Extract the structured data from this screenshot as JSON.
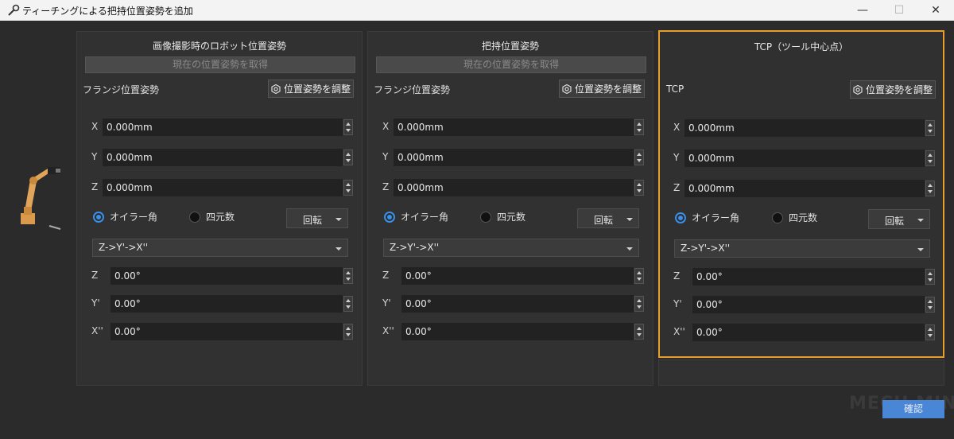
{
  "window": {
    "title": "ティーチングによる把持位置姿勢を追加",
    "icon": "wrench-icon",
    "minimize": "—",
    "maximize": "☐",
    "close": "✕"
  },
  "colors": {
    "accent": "#e89c2c",
    "primary": "#4a86d6",
    "radio": "#3a8fe8"
  },
  "panels": [
    {
      "title": "画像撮影時のロボット位置姿勢",
      "get_button": "現在の位置姿勢を取得",
      "pose_label": "フランジ位置姿勢",
      "adjust_button": "位置姿勢を調整",
      "x_label": "X",
      "x_value": "0.000mm",
      "y_label": "Y",
      "y_value": "0.000mm",
      "z_label": "Z",
      "z_value": "0.000mm",
      "euler_label": "オイラー角",
      "quat_label": "四元数",
      "rotation_select": "回転",
      "order_select": "Z->Y'->X''",
      "rz_label": "Z",
      "rz_value": "0.00°",
      "ry_label": "Y'",
      "ry_value": "0.00°",
      "rx_label": "X''",
      "rx_value": "0.00°"
    },
    {
      "title": "把持位置姿勢",
      "get_button": "現在の位置姿勢を取得",
      "pose_label": "フランジ位置姿勢",
      "adjust_button": "位置姿勢を調整",
      "x_label": "X",
      "x_value": "0.000mm",
      "y_label": "Y",
      "y_value": "0.000mm",
      "z_label": "Z",
      "z_value": "0.000mm",
      "euler_label": "オイラー角",
      "quat_label": "四元数",
      "rotation_select": "回転",
      "order_select": "Z->Y'->X''",
      "rz_label": "Z",
      "rz_value": "0.00°",
      "ry_label": "Y'",
      "ry_value": "0.00°",
      "rx_label": "X''",
      "rx_value": "0.00°"
    },
    {
      "title": "TCP（ツール中心点）",
      "pose_label": "TCP",
      "adjust_button": "位置姿勢を調整",
      "x_label": "X",
      "x_value": "0.000mm",
      "y_label": "Y",
      "y_value": "0.000mm",
      "z_label": "Z",
      "z_value": "0.000mm",
      "euler_label": "オイラー角",
      "quat_label": "四元数",
      "rotation_select": "回転",
      "order_select": "Z->Y'->X''",
      "rz_label": "Z",
      "rz_value": "0.00°",
      "ry_label": "Y'",
      "ry_value": "0.00°",
      "rx_label": "X''",
      "rx_value": "0.00°"
    }
  ],
  "confirm_button": "確認",
  "watermark": "MECH MIND"
}
